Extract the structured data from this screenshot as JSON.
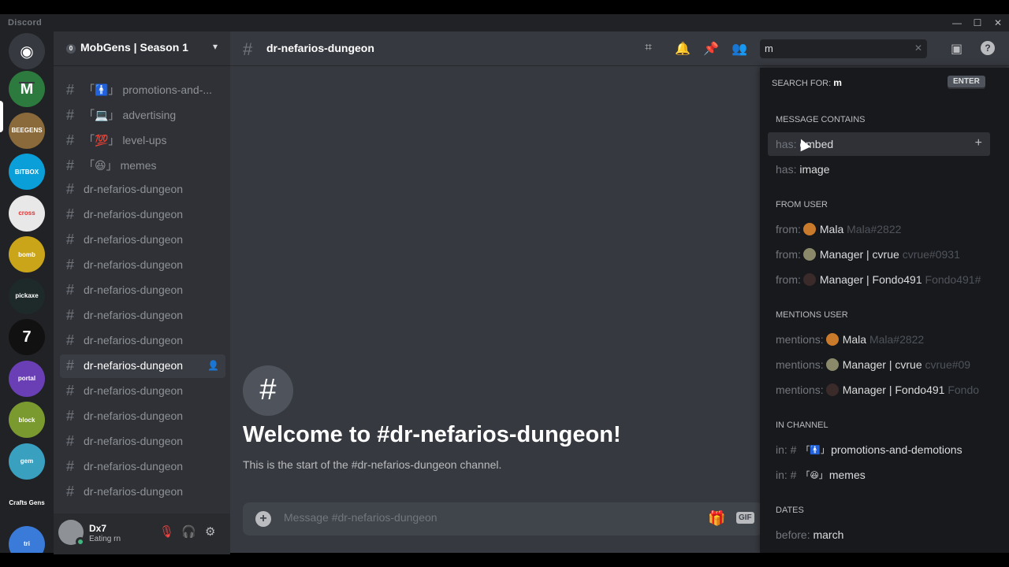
{
  "window": {
    "title": "Discord",
    "controls": [
      "minimize",
      "maximize",
      "close"
    ]
  },
  "server": {
    "badge": "0",
    "name": "MobGens | Season 1"
  },
  "guilds": [
    {
      "name": "home",
      "icon": "discord-logo-icon"
    },
    {
      "name": "M",
      "color": "#2c7a3e",
      "selected": true
    },
    {
      "name": "BEEGENS",
      "color": "#8a6a3a"
    },
    {
      "name": "BITBOX",
      "color": "#0a9fd8"
    },
    {
      "name": "cross",
      "color": "#e8e8e8"
    },
    {
      "name": "bomb",
      "color": "#caa51a"
    },
    {
      "name": "pickaxe",
      "color": "#1e2a2a"
    },
    {
      "name": "7",
      "color": "#111111"
    },
    {
      "name": "portal",
      "color": "#6a3fb5"
    },
    {
      "name": "block",
      "color": "#7a9a30"
    },
    {
      "name": "gem",
      "color": "#3aa0c0"
    },
    {
      "name": "Crafts Gens",
      "color": "#202225"
    },
    {
      "name": "tri",
      "color": "#3a7ad8"
    }
  ],
  "channels": [
    {
      "prefix": "「🚹」",
      "name": "promotions-and-..."
    },
    {
      "prefix": "「💻」",
      "name": "advertising"
    },
    {
      "prefix": "「💯」",
      "name": "level-ups"
    },
    {
      "prefix": "「😆」",
      "name": "memes"
    },
    {
      "prefix": "",
      "name": "dr-nefarios-dungeon"
    },
    {
      "prefix": "",
      "name": "dr-nefarios-dungeon"
    },
    {
      "prefix": "",
      "name": "dr-nefarios-dungeon"
    },
    {
      "prefix": "",
      "name": "dr-nefarios-dungeon"
    },
    {
      "prefix": "",
      "name": "dr-nefarios-dungeon"
    },
    {
      "prefix": "",
      "name": "dr-nefarios-dungeon"
    },
    {
      "prefix": "",
      "name": "dr-nefarios-dungeon"
    },
    {
      "prefix": "",
      "name": "dr-nefarios-dungeon",
      "active": true
    },
    {
      "prefix": "",
      "name": "dr-nefarios-dungeon"
    },
    {
      "prefix": "",
      "name": "dr-nefarios-dungeon"
    },
    {
      "prefix": "",
      "name": "dr-nefarios-dungeon"
    },
    {
      "prefix": "",
      "name": "dr-nefarios-dungeon"
    },
    {
      "prefix": "",
      "name": "dr-nefarios-dungeon"
    }
  ],
  "user": {
    "name": "Dx7",
    "status": "Eating rn"
  },
  "topbar": {
    "channel": "dr-nefarios-dungeon",
    "search_value": "m"
  },
  "welcome": {
    "title": "Welcome to #dr-nefarios-dungeon!",
    "subtitle": "This is the start of the #dr-nefarios-dungeon channel."
  },
  "composer": {
    "placeholder": "Message #dr-nefarios-dungeon",
    "gif_label": "GIF"
  },
  "search_popout": {
    "search_for_label": "SEARCH FOR:",
    "search_for_value": "m",
    "enter_label": "ENTER",
    "sections": {
      "message_contains": "MESSAGE CONTAINS",
      "from_user": "FROM USER",
      "mentions_user": "MENTIONS USER",
      "in_channel": "IN CHANNEL",
      "dates": "DATES"
    },
    "contains": [
      {
        "key": "has:",
        "value": "embed"
      },
      {
        "key": "has:",
        "value": "image"
      }
    ],
    "from": [
      {
        "key": "from:",
        "name": "Mala",
        "tag": "Mala#2822",
        "color": "#c97a2a"
      },
      {
        "key": "from:",
        "name": "Manager | cvrue",
        "tag": "cvrue#0931",
        "color": "#8a8a6a"
      },
      {
        "key": "from:",
        "name": "Manager | Fondo491",
        "tag": "Fondo491#",
        "color": "#3a2a2a"
      }
    ],
    "mentions": [
      {
        "key": "mentions:",
        "name": "Mala",
        "tag": "Mala#2822",
        "color": "#c97a2a"
      },
      {
        "key": "mentions:",
        "name": "Manager | cvrue",
        "tag": "cvrue#09",
        "color": "#8a8a6a"
      },
      {
        "key": "mentions:",
        "name": "Manager | Fondo491",
        "tag": "Fondo",
        "color": "#3a2a2a"
      }
    ],
    "in": [
      {
        "key": "in:",
        "prefix": "「🚹」",
        "name": "promotions-and-demotions"
      },
      {
        "key": "in:",
        "prefix": "「😆」",
        "name": "memes"
      }
    ],
    "dates": [
      {
        "key": "before:",
        "value": "march"
      }
    ]
  }
}
